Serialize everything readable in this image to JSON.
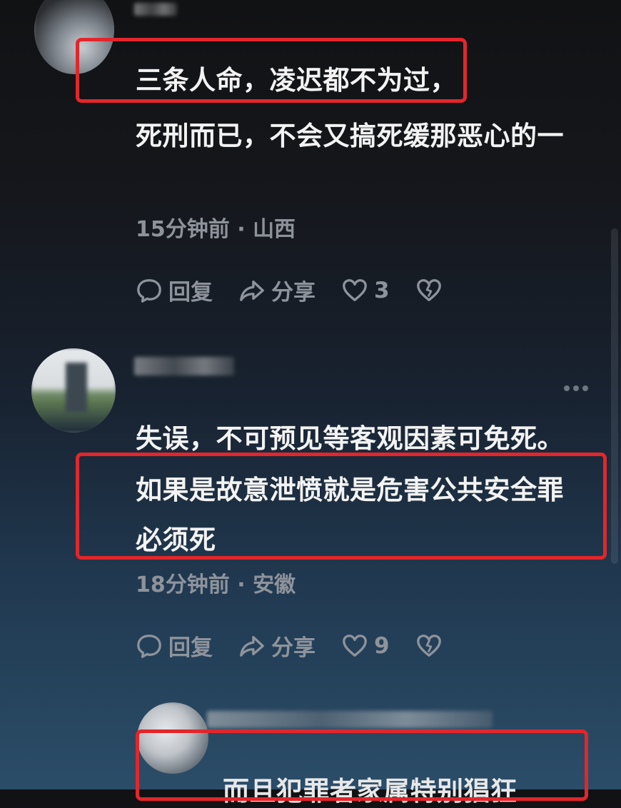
{
  "comments": [
    {
      "lines": [
        "三条人命，凌迟都不为过，",
        "死刑而已，不会又搞死缓那恶心的一"
      ],
      "time": "15分钟前",
      "location": "山西",
      "reply_label": "回复",
      "share_label": "分享",
      "likes": "3"
    },
    {
      "lines": [
        "失误，不可预见等客观因素可免死。",
        "如果是故意泄愤就是危害公共安全罪",
        "必须死"
      ],
      "time": "18分钟前",
      "location": "安徽",
      "reply_label": "回复",
      "share_label": "分享",
      "likes": "9"
    },
    {
      "lines": [
        "而且犯罪者家属特别猖狂"
      ]
    }
  ],
  "separator": "·",
  "colors": {
    "highlight": "#e3262b",
    "meta": "#8e939b",
    "text": "#f3f3f3"
  },
  "icons": [
    "comment-bubble-icon",
    "share-arrow-icon",
    "heart-icon",
    "broken-heart-icon",
    "more-dots-icon"
  ]
}
